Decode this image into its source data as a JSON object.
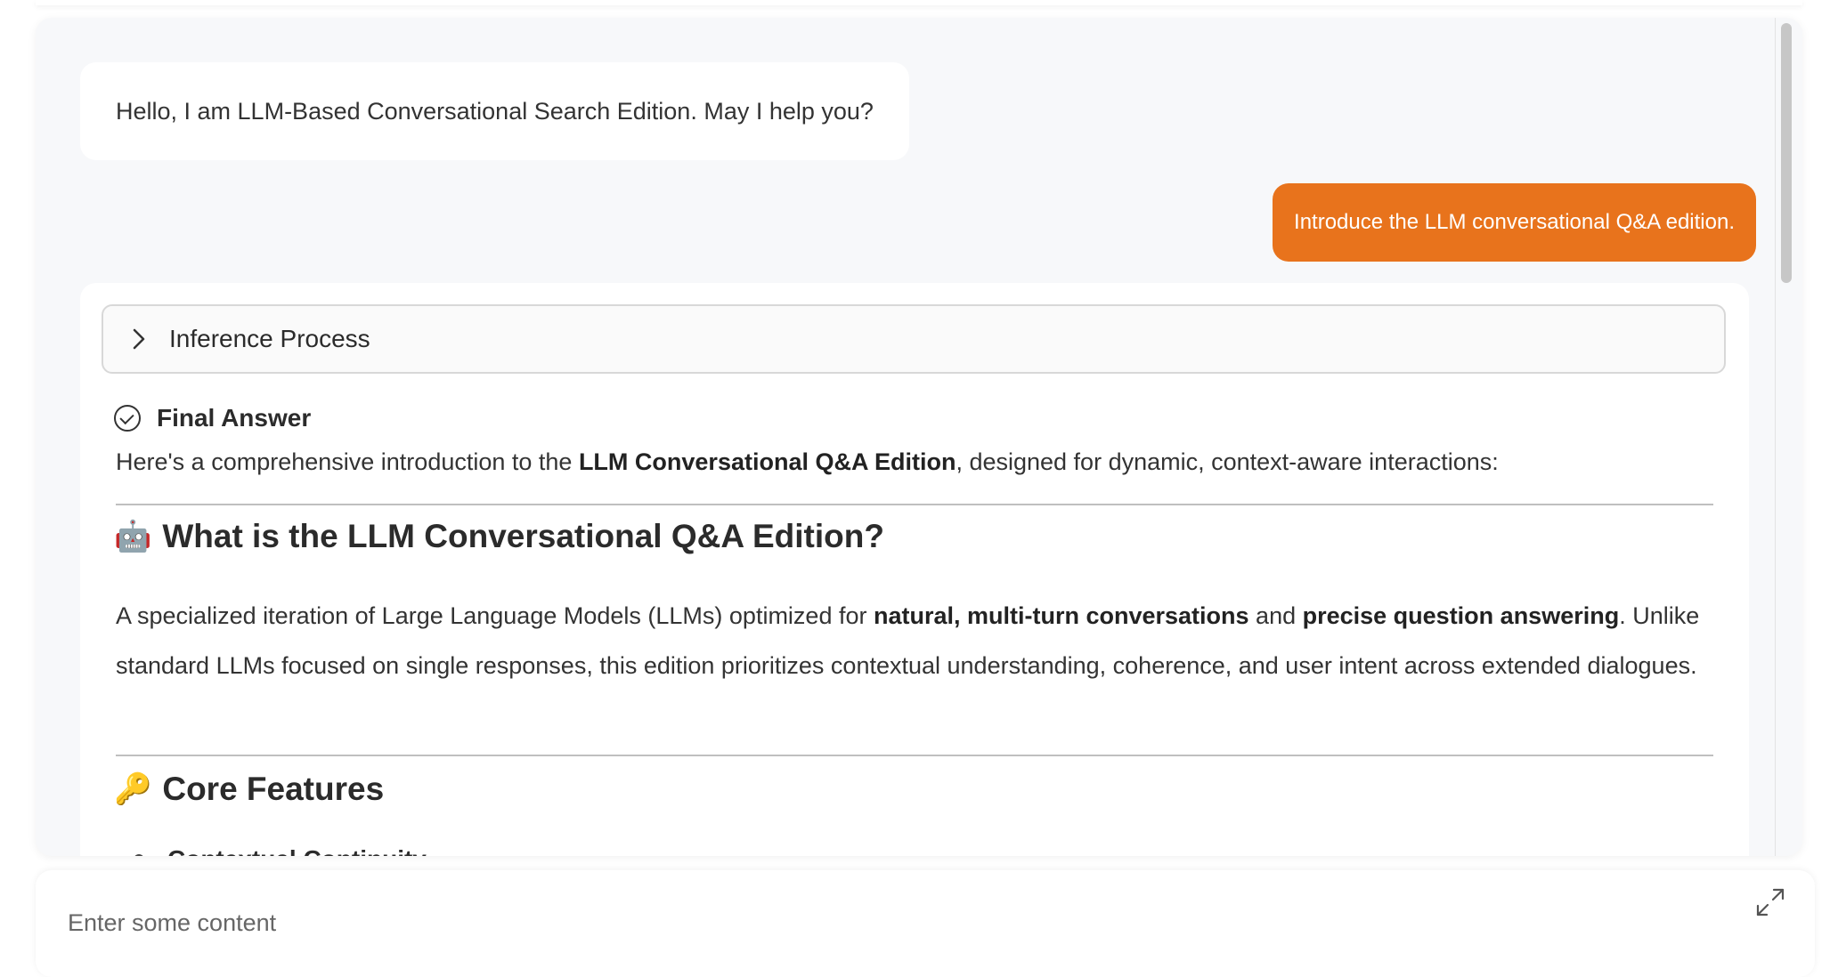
{
  "chat": {
    "greeting": "Hello, I am LLM-Based Conversational Search Edition. May I help you?",
    "user_message": "Introduce the LLM conversational Q&A edition.",
    "answer": {
      "inference_label": "Inference Process",
      "final_label": "Final Answer",
      "intro_before": "Here's a comprehensive introduction to the ",
      "intro_bold": "LLM Conversational Q&A Edition",
      "intro_after": ", designed for dynamic, context-aware interactions:",
      "section1_emoji": "🤖",
      "section1_title": "What is the LLM Conversational Q&A Edition?",
      "para_part1": "A specialized iteration of Large Language Models (LLMs) optimized for ",
      "para_bold1": "natural, multi-turn conversations",
      "para_part2": " and ",
      "para_bold2": "precise question answering",
      "para_part3": ". Unlike standard LLMs focused on single responses, this edition prioritizes contextual understanding, coherence, and user intent across extended dialogues.",
      "section2_emoji": "🔑",
      "section2_title": "Core Features",
      "bullet1": "Contextual Continuity"
    }
  },
  "input": {
    "placeholder": "Enter some content"
  },
  "colors": {
    "accent": "#e8731c",
    "panel_bg": "#f7f8fa"
  },
  "icons": {
    "inference_toggle": "chevron-right-icon",
    "final_answer": "check-circle-icon",
    "expand": "expand-icon"
  }
}
